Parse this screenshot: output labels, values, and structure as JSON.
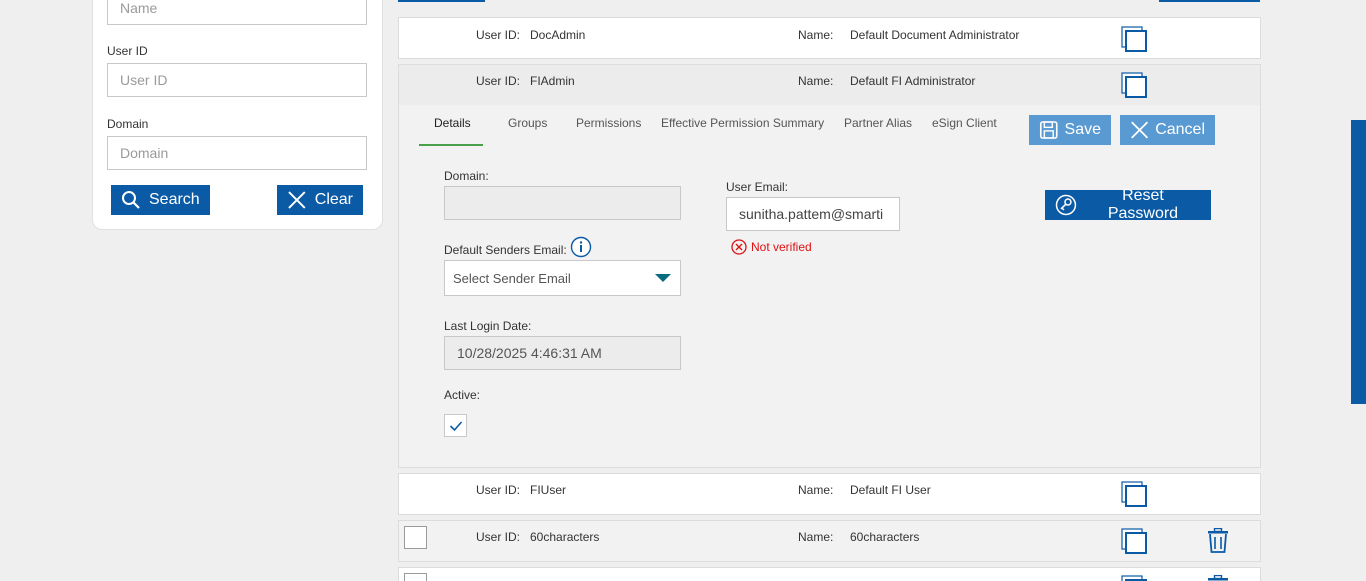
{
  "search": {
    "name_placeholder": "Name",
    "user_id_label": "User ID",
    "user_id_placeholder": "User ID",
    "domain_label": "Domain",
    "domain_placeholder": "Domain",
    "search_button": "Search",
    "clear_button": "Clear"
  },
  "users": [
    {
      "id_label": "User ID:",
      "id": "DocAdmin",
      "name_label": "Name:",
      "name": "Default Document Administrator"
    },
    {
      "id_label": "User ID:",
      "id": "FIAdmin",
      "name_label": "Name:",
      "name": "Default FI Administrator"
    },
    {
      "id_label": "User ID:",
      "id": "FIUser",
      "name_label": "Name:",
      "name": "Default FI User"
    },
    {
      "id_label": "User ID:",
      "id": "60characters",
      "name_label": "Name:",
      "name": "60characters"
    }
  ],
  "detail": {
    "tabs": [
      "Details",
      "Groups",
      "Permissions",
      "Effective Permission Summary",
      "Partner Alias",
      "eSign Client"
    ],
    "save_button": "Save",
    "cancel_button": "Cancel",
    "reset_password_button": "Reset Password",
    "domain_label": "Domain:",
    "domain_value": "",
    "user_email_label": "User Email:",
    "user_email_value": "sunitha.pattem@smarti",
    "not_verified": "Not verified",
    "default_senders_email_label": "Default Senders Email:",
    "sender_email_placeholder": "Select Sender Email",
    "last_login_label": "Last Login Date:",
    "last_login_value": "10/28/2025 4:46:31 AM",
    "active_label": "Active:",
    "active_checked": true
  },
  "colors": {
    "primary": "#0a5aa6",
    "primary_light": "#5a9ad2",
    "error": "#dd1111",
    "tab_active_underline": "#4aa04a"
  }
}
